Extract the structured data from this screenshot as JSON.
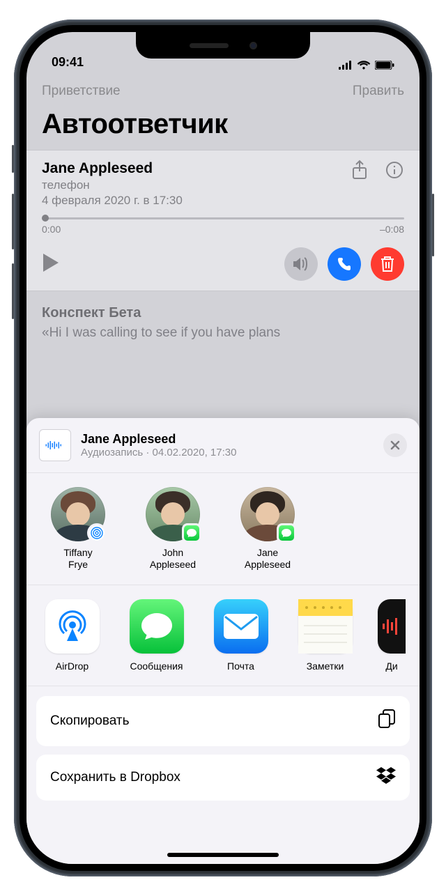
{
  "statusbar": {
    "time": "09:41"
  },
  "nav": {
    "left": "Приветствие",
    "right": "Править"
  },
  "title": "Автоответчик",
  "voicemail": {
    "name": "Jane Appleseed",
    "source": "телефон",
    "datetime": "4 февраля 2020 г. в 17:30",
    "time_current": "0:00",
    "time_remaining": "–0:08"
  },
  "transcript": {
    "heading": "Конспект Бета",
    "text": "«Hi I was calling to see if you have plans"
  },
  "share": {
    "title": "Jane Appleseed",
    "subtitle": "Аудиозапись · 04.02.2020, 17:30",
    "contacts": [
      {
        "name_line1": "Tiffany",
        "name_line2": "Frye",
        "badge": "airdrop"
      },
      {
        "name_line1": "John",
        "name_line2": "Appleseed",
        "badge": "msg"
      },
      {
        "name_line1": "Jane",
        "name_line2": "Appleseed",
        "badge": "msg"
      }
    ],
    "apps": [
      {
        "label": "AirDrop"
      },
      {
        "label": "Сообщения"
      },
      {
        "label": "Почта"
      },
      {
        "label": "Заметки"
      },
      {
        "label_partial": "Ди"
      }
    ],
    "actions": {
      "copy": "Скопировать",
      "dropbox": "Сохранить в Dropbox"
    }
  }
}
